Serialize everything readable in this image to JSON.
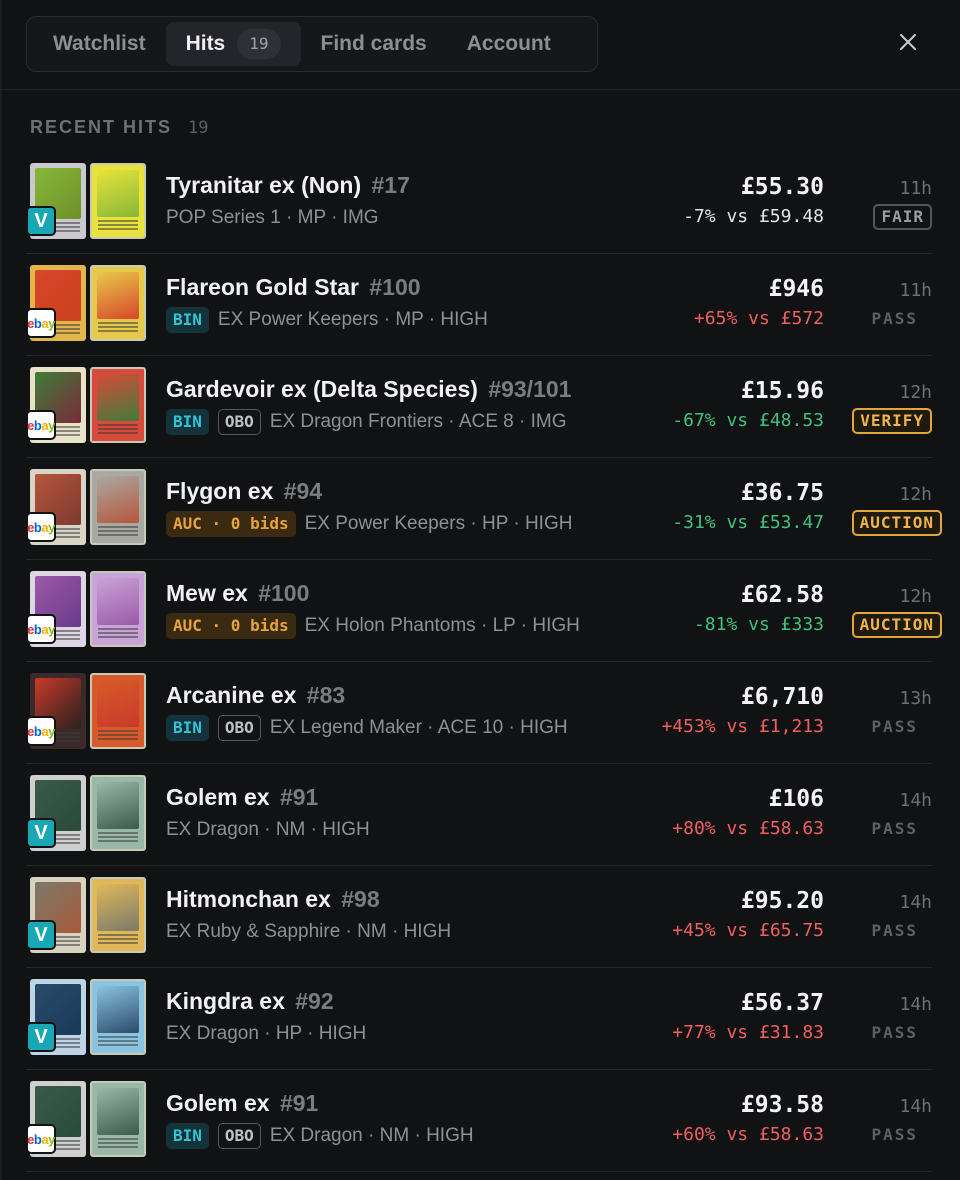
{
  "tabs": [
    {
      "label": "Watchlist",
      "active": false
    },
    {
      "label": "Hits",
      "active": true,
      "count": "19"
    },
    {
      "label": "Find cards",
      "active": false
    },
    {
      "label": "Account",
      "active": false
    }
  ],
  "section": {
    "title": "RECENT HITS",
    "count": "19"
  },
  "colors": {
    "background": "#111214",
    "up": "#ef5f5f",
    "down": "#3fc27c",
    "accent_cyan": "#33c3d6",
    "accent_amber": "#e8a33a"
  },
  "hits": [
    {
      "name": "Tyranitar ex (Non)",
      "number": "#17",
      "source": "V",
      "chips": [],
      "meta": "POP Series 1 · MP · IMG",
      "price": "£55.30",
      "delta": "-7% vs £59.48",
      "delta_dir": "neutral",
      "age": "11h",
      "badge": "FAIR",
      "badge_type": "fair",
      "art": [
        "#c9c9cf",
        "#86b838",
        "#e9e23a",
        "#6f8f2a"
      ]
    },
    {
      "name": "Flareon Gold Star",
      "number": "#100",
      "source": "ebay",
      "chips": [
        "BIN"
      ],
      "meta": "EX Power Keepers · MP · HIGH",
      "price": "£946",
      "delta": "+65% vs £572",
      "delta_dir": "up",
      "age": "11h",
      "badge": "PASS",
      "badge_type": "pass",
      "art": [
        "#e2b64a",
        "#d8462a",
        "#e7c94a",
        "#c8421e"
      ]
    },
    {
      "name": "Gardevoir ex (Delta Species)",
      "number": "#93/101",
      "source": "ebay",
      "chips": [
        "BIN",
        "OBO"
      ],
      "meta": "EX Dragon Frontiers · ACE 8 · IMG",
      "price": "£15.96",
      "delta": "-67% vs £48.53",
      "delta_dir": "down",
      "age": "12h",
      "badge": "VERIFY",
      "badge_type": "verify",
      "art": [
        "#e8e2c8",
        "#3f7d3a",
        "#d84a3a",
        "#7a2a3a"
      ]
    },
    {
      "name": "Flygon ex",
      "number": "#94",
      "source": "ebay",
      "chips": [
        "AUC · 0 bids"
      ],
      "meta": "EX Power Keepers · HP · HIGH",
      "price": "£36.75",
      "delta": "-31% vs £53.47",
      "delta_dir": "down",
      "age": "12h",
      "badge": "AUCTION",
      "badge_type": "auction",
      "art": [
        "#d8d4c6",
        "#b8553a",
        "#a9a9a3",
        "#7a3a30"
      ]
    },
    {
      "name": "Mew ex",
      "number": "#100",
      "source": "ebay",
      "chips": [
        "AUC · 0 bids"
      ],
      "meta": "EX Holon Phantoms · LP · HIGH",
      "price": "£62.58",
      "delta": "-81% vs £333",
      "delta_dir": "down",
      "age": "12h",
      "badge": "AUCTION",
      "badge_type": "auction",
      "art": [
        "#ddd6e4",
        "#9a5aa8",
        "#c9a3d8",
        "#6a3a8a"
      ]
    },
    {
      "name": "Arcanine ex",
      "number": "#83",
      "source": "ebay",
      "chips": [
        "BIN",
        "OBO"
      ],
      "meta": "EX Legend Maker · ACE 10 · HIGH",
      "price": "£6,710",
      "delta": "+453% vs £1,213",
      "delta_dir": "up",
      "age": "13h",
      "badge": "PASS",
      "badge_type": "pass",
      "art": [
        "#3a2a2a",
        "#c83a2a",
        "#d85a2a",
        "#2a2020"
      ]
    },
    {
      "name": "Golem ex",
      "number": "#91",
      "source": "V",
      "chips": [],
      "meta": "EX Dragon · NM · HIGH",
      "price": "£106",
      "delta": "+80% vs £58.63",
      "delta_dir": "up",
      "age": "14h",
      "badge": "PASS",
      "badge_type": "pass",
      "art": [
        "#cfcfcf",
        "#3a5a4a",
        "#9ab8a8",
        "#2a4a3a"
      ]
    },
    {
      "name": "Hitmonchan ex",
      "number": "#98",
      "source": "V",
      "chips": [],
      "meta": "EX Ruby & Sapphire · NM · HIGH",
      "price": "£95.20",
      "delta": "+45% vs £65.75",
      "delta_dir": "up",
      "age": "14h",
      "badge": "PASS",
      "badge_type": "pass",
      "art": [
        "#d8d2c0",
        "#7a7a6a",
        "#e0b85a",
        "#a85a3a"
      ]
    },
    {
      "name": "Kingdra ex",
      "number": "#92",
      "source": "V",
      "chips": [],
      "meta": "EX Dragon · HP · HIGH",
      "price": "£56.37",
      "delta": "+77% vs £31.83",
      "delta_dir": "up",
      "age": "14h",
      "badge": "PASS",
      "badge_type": "pass",
      "art": [
        "#bcd4e4",
        "#2a4a6a",
        "#8ac4e0",
        "#1a3a5a"
      ]
    },
    {
      "name": "Golem ex",
      "number": "#91",
      "source": "ebay",
      "chips": [
        "BIN",
        "OBO"
      ],
      "meta": "EX Dragon · NM · HIGH",
      "price": "£93.58",
      "delta": "+60% vs £58.63",
      "delta_dir": "up",
      "age": "14h",
      "badge": "PASS",
      "badge_type": "pass",
      "art": [
        "#cfcfcf",
        "#3a5a4a",
        "#9ab8a8",
        "#2a4a3a"
      ]
    }
  ]
}
